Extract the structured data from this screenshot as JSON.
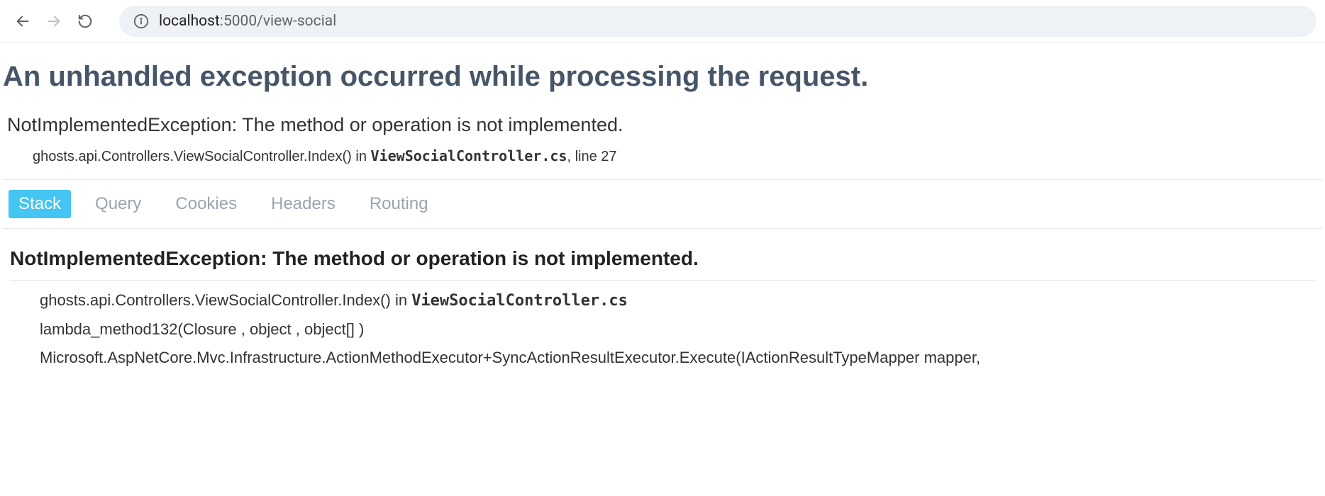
{
  "address_bar": {
    "host": "localhost",
    "port_path": ":5000/view-social"
  },
  "error": {
    "title": "An unhandled exception occurred while processing the request.",
    "exception_name": "NotImplementedException: The method or operation is not implemented.",
    "location_prefix": "ghosts.api.Controllers.ViewSocialController.Index() in ",
    "location_file": "ViewSocialController.cs",
    "location_suffix": ", line 27"
  },
  "tabs": {
    "stack": "Stack",
    "query": "Query",
    "cookies": "Cookies",
    "headers": "Headers",
    "routing": "Routing"
  },
  "stack": {
    "title": "NotImplementedException: The method or operation is not implemented.",
    "frames": [
      {
        "prefix": "ghosts.api.Controllers.ViewSocialController.Index() in ",
        "file": "ViewSocialController.cs",
        "suffix": ""
      },
      {
        "prefix": "lambda_method132(Closure , object , object[] )",
        "file": "",
        "suffix": ""
      },
      {
        "prefix": "Microsoft.AspNetCore.Mvc.Infrastructure.ActionMethodExecutor+SyncActionResultExecutor.Execute(IActionResultTypeMapper mapper,",
        "file": "",
        "suffix": ""
      }
    ]
  }
}
